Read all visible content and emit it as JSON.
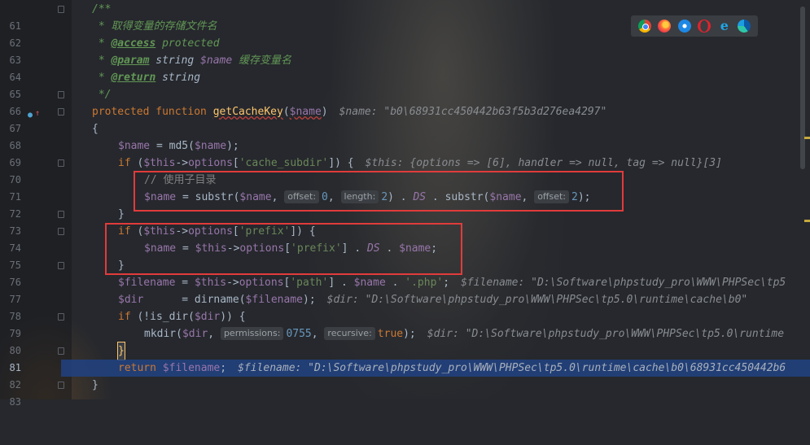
{
  "editor": {
    "line_numbers": [
      "61",
      "62",
      "63",
      "64",
      "65",
      "66",
      "67",
      "68",
      "69",
      "70",
      "71",
      "72",
      "73",
      "74",
      "75",
      "76",
      "77",
      "78",
      "79",
      "80",
      "81",
      "82",
      "83"
    ],
    "current_line": "81",
    "highlighted_line": "82"
  },
  "code": {
    "l61": "/**",
    "l62": " * 取得变量的存储文件名",
    "l63_prefix": " * ",
    "l63_tag": "@access",
    "l63_rest": " protected",
    "l64_prefix": " * ",
    "l64_tag": "@param",
    "l64_type": " string ",
    "l64_var": "$name",
    "l64_desc": " 缓存变量名",
    "l65_prefix": " * ",
    "l65_tag": "@return",
    "l65_rest": " string",
    "l66": " */",
    "l67_kw": "protected function ",
    "l67_fn": "getCacheKey",
    "l67_open": "(",
    "l67_var": "$name",
    "l67_close": ")",
    "l67_hint": "$name: \"b0\\68931cc450442b63f5b3d276ea4297\"",
    "l68": "{",
    "l69_var1": "$name",
    "l69_mid": " = md5(",
    "l69_var2": "$name",
    "l69_end": ");",
    "l70_kw": "if",
    "l70_a": " (",
    "l70_this": "$this",
    "l70_b": "->",
    "l70_prop": "options",
    "l70_c": "[",
    "l70_str": "'cache_subdir'",
    "l70_d": "]) {",
    "l70_hint": "$this: {options => [6], handler => null, tag => null}[3]",
    "l71": "// 使用子目录",
    "l72_var1": "$name",
    "l72_a": " = substr(",
    "l72_var2": "$name",
    "l72_comma": ", ",
    "l72_inlay1": "offset:",
    "l72_num1": "0",
    "l72_inlay2": "length:",
    "l72_num2": "2",
    "l72_b": ") . ",
    "l72_ds": "DS",
    "l72_c": " . substr(",
    "l72_var3": "$name",
    "l72_inlay3": "offset:",
    "l72_num3": "2",
    "l72_end": ");",
    "l73": "}",
    "l74_kw": "if",
    "l74_a": " (",
    "l74_this": "$this",
    "l74_b": "->",
    "l74_prop": "options",
    "l74_c": "[",
    "l74_str": "'prefix'",
    "l74_d": "]) {",
    "l75_var1": "$name",
    "l75_a": " = ",
    "l75_this": "$this",
    "l75_b": "->",
    "l75_prop": "options",
    "l75_c": "[",
    "l75_str": "'prefix'",
    "l75_d": "] . ",
    "l75_ds": "DS",
    "l75_e": " . ",
    "l75_var2": "$name",
    "l75_end": ";",
    "l76": "}",
    "l77_var1": "$filename",
    "l77_a": " = ",
    "l77_this": "$this",
    "l77_b": "->",
    "l77_prop": "options",
    "l77_c": "[",
    "l77_str": "'path'",
    "l77_d": "] . ",
    "l77_var2": "$name",
    "l77_e": " . ",
    "l77_str2": "'.php'",
    "l77_end": ";",
    "l77_hint": "$filename: \"D:\\Software\\phpstudy_pro\\WWW\\PHPSec\\tp5",
    "l78_var1": "$dir",
    "l78_a": "      = dirname(",
    "l78_var2": "$filename",
    "l78_end": ");",
    "l78_hint": "$dir: \"D:\\Software\\phpstudy_pro\\WWW\\PHPSec\\tp5.0\\runtime\\cache\\b0\"",
    "l79_kw": "if",
    "l79_a": " (!is_dir(",
    "l79_var": "$dir",
    "l79_end": ")) {",
    "l80_a": "mkdir(",
    "l80_var": "$dir",
    "l80_comma": ", ",
    "l80_inlay1": "permissions:",
    "l80_num1": "0755",
    "l80_inlay2": "recursive:",
    "l80_kw": "true",
    "l80_end": ");",
    "l80_hint": "$dir: \"D:\\Software\\phpstudy_pro\\WWW\\PHPSec\\tp5.0\\runtime",
    "l81": "}",
    "l82_kw": "return ",
    "l82_var": "$filename",
    "l82_end": ";",
    "l82_hint": "$filename: \"D:\\Software\\phpstudy_pro\\WWW\\PHPSec\\tp5.0\\runtime\\cache\\b0\\68931cc450442b6",
    "l83": "}"
  },
  "browser_icons": [
    "chrome-icon",
    "firefox-icon",
    "safari-icon",
    "opera-icon",
    "ie-icon",
    "edge-icon"
  ],
  "colors": {
    "keyword": "#cc7832",
    "function": "#ffc66d",
    "variable": "#9876aa",
    "string": "#6a8759",
    "number": "#6897bb",
    "doc_comment": "#629755",
    "highlight_row": "#214283",
    "annotation_box": "#e13b3b"
  }
}
